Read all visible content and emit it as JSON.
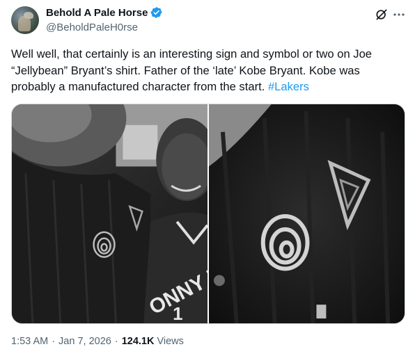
{
  "author": {
    "display_name": "Behold A Pale Horse",
    "handle": "@BeholdPaleH0rse",
    "verified": true
  },
  "tweet": {
    "text_before_hashtag": "Well well, that certainly is an interesting sign and symbol or two on Joe “Jellybean” Bryant’s shirt. Father of the ‘late’ Kobe Bryant. Kobe was probably a manufactured character from the start. ",
    "hashtag": "#Lakers"
  },
  "meta": {
    "time": "1:53 AM",
    "date": "Jan 7, 2026",
    "separator": "·",
    "views_count": "124.1K",
    "views_label": "Views"
  },
  "photos": {
    "left_jersey_text": "ONNY H",
    "left_jersey_number": "1"
  },
  "colors": {
    "accent": "#1d9bf0",
    "text": "#0f1419",
    "secondary": "#536471",
    "border": "#cfd9de"
  },
  "icons": {
    "verified": "verified-badge-icon",
    "grok": "grok-icon",
    "more": "more-options-icon"
  }
}
